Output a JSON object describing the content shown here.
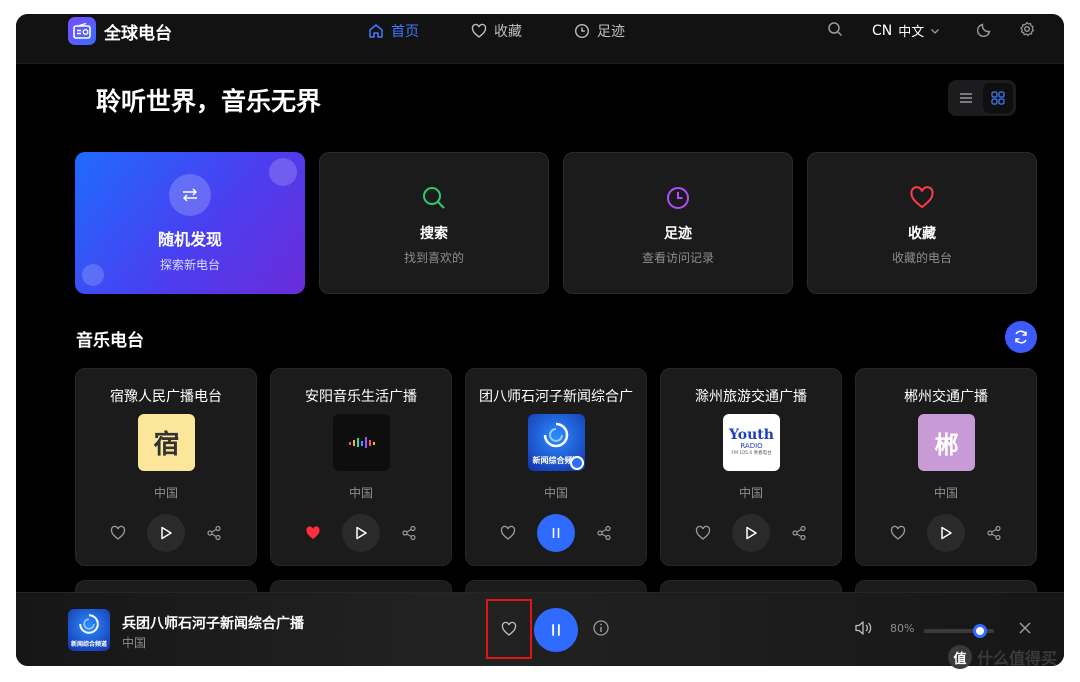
{
  "app": {
    "title": "全球电台"
  },
  "nav": [
    {
      "label": "首页",
      "icon": "home-icon",
      "active": true
    },
    {
      "label": "收藏",
      "icon": "heart-icon",
      "active": false
    },
    {
      "label": "足迹",
      "icon": "clock-icon",
      "active": false
    }
  ],
  "header": {
    "lang_code": "CN",
    "lang_name": "中文"
  },
  "hero": {
    "title": "聆听世界，音乐无界"
  },
  "features": [
    {
      "title": "随机发现",
      "subtitle": "探索新电台",
      "icon": "shuffle-icon"
    },
    {
      "title": "搜索",
      "subtitle": "找到喜欢的",
      "icon": "search-icon",
      "color": "#2ecc71"
    },
    {
      "title": "足迹",
      "subtitle": "查看访问记录",
      "icon": "clock-icon",
      "color": "#b04dff"
    },
    {
      "title": "收藏",
      "subtitle": "收藏的电台",
      "icon": "heart-icon",
      "color": "#ff3b4a"
    }
  ],
  "section": {
    "title": "音乐电台"
  },
  "stations": [
    {
      "name": "宿豫人民广播电台",
      "country": "中国",
      "logo_text": "宿",
      "logo_bg": "#fbe69a",
      "logo_color": "#333333",
      "favorited": false,
      "playing": false
    },
    {
      "name": "安阳音乐生活广播",
      "country": "中国",
      "logo_text": "",
      "logo_bg": "#0e0e0e",
      "favorited": true,
      "playing": false
    },
    {
      "name": "团八师石河子新闻综合广",
      "country": "中国",
      "logo_text": "新闻综合频道",
      "logo_bg": "#1b3fbf",
      "favorited": false,
      "playing": true
    },
    {
      "name": "滁州旅游交通广播",
      "country": "中国",
      "logo_text": "Youth",
      "logo_subtext": "RADIO",
      "logo_caption": "FM 105.4 青春电台",
      "logo_bg": "#ffffff",
      "favorited": false,
      "playing": false
    },
    {
      "name": "郴州交通广播",
      "country": "中国",
      "logo_text": "郴",
      "logo_bg": "#c89ad6",
      "logo_color": "#ffffff",
      "favorited": false,
      "playing": false
    }
  ],
  "player": {
    "station_name": "兵团八师石河子新闻综合广播",
    "country": "中国",
    "art_text": "新闻综合频道",
    "volume_label": "80%",
    "volume": 0.8
  },
  "watermark": {
    "text": "什么值得买",
    "badge": "值"
  },
  "colors": {
    "accent": "#2f6bff",
    "background": "#000000",
    "card": "#1b1b1c",
    "favorite": "#ff2d3d"
  }
}
